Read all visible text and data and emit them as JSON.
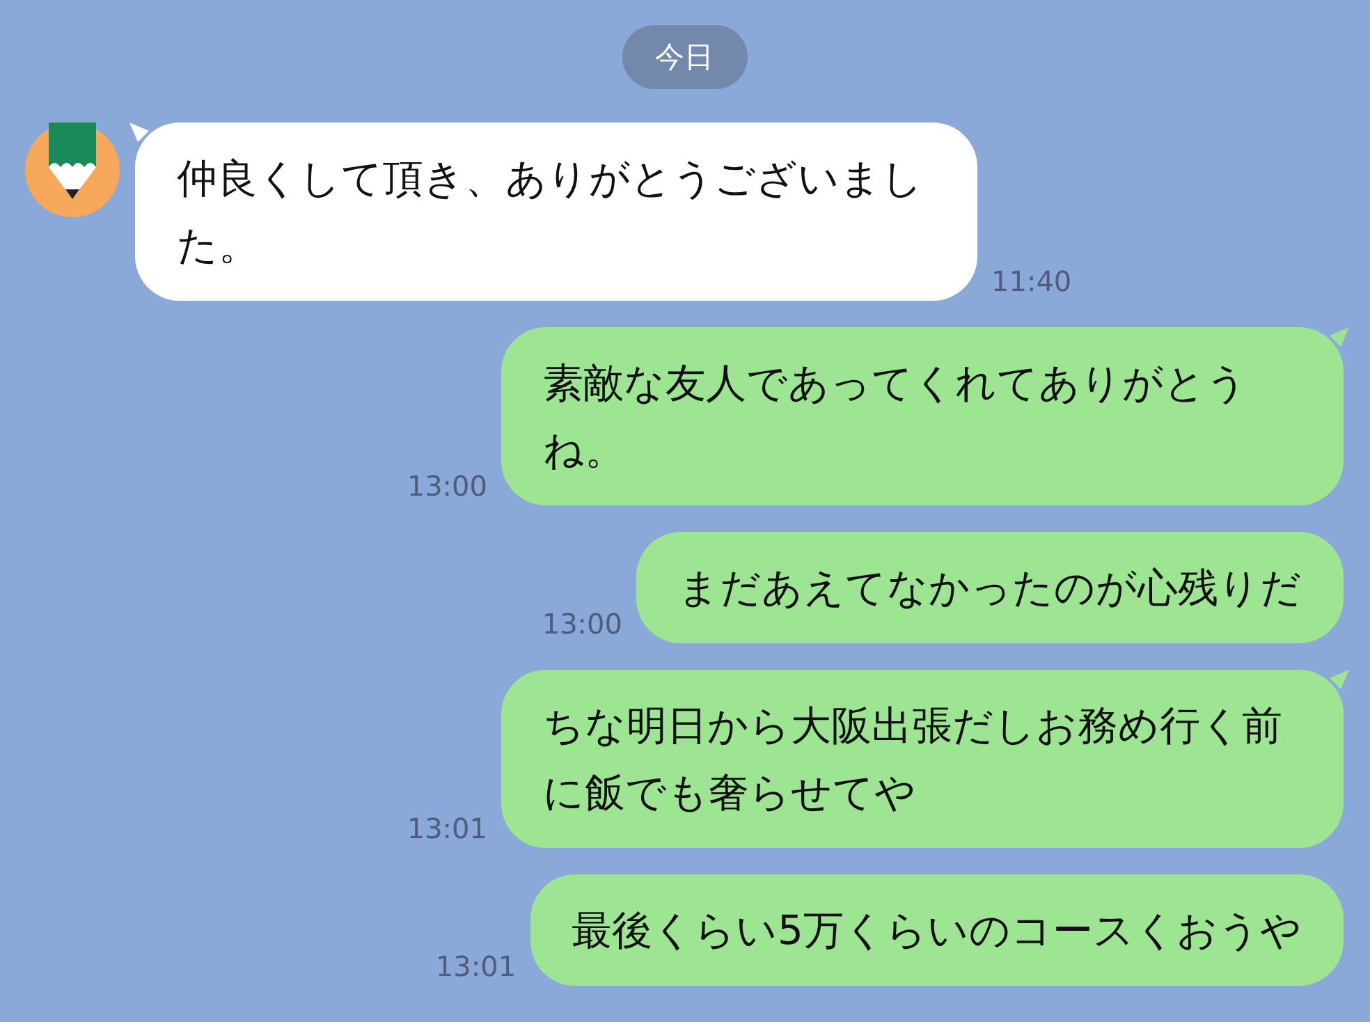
{
  "date_label": "今日",
  "messages": [
    {
      "kind": "received",
      "text": "仲良くして頂き、ありがとうございました。",
      "time": "11:40",
      "tail": true
    },
    {
      "kind": "sent",
      "text": "素敵な友人であってくれてありがとうね。",
      "time": "13:00",
      "tail": true
    },
    {
      "kind": "sent",
      "text": "まだあえてなかったのが心残りだ",
      "time": "13:00",
      "tail": false
    },
    {
      "kind": "sent",
      "text": "ちな明日から大阪出張だしお務め行く前に飯でも奢らせてや",
      "time": "13:01",
      "tail": true
    },
    {
      "kind": "sent",
      "text": "最後くらい5万くらいのコースくおうや",
      "time": "13:01",
      "tail": false
    }
  ]
}
